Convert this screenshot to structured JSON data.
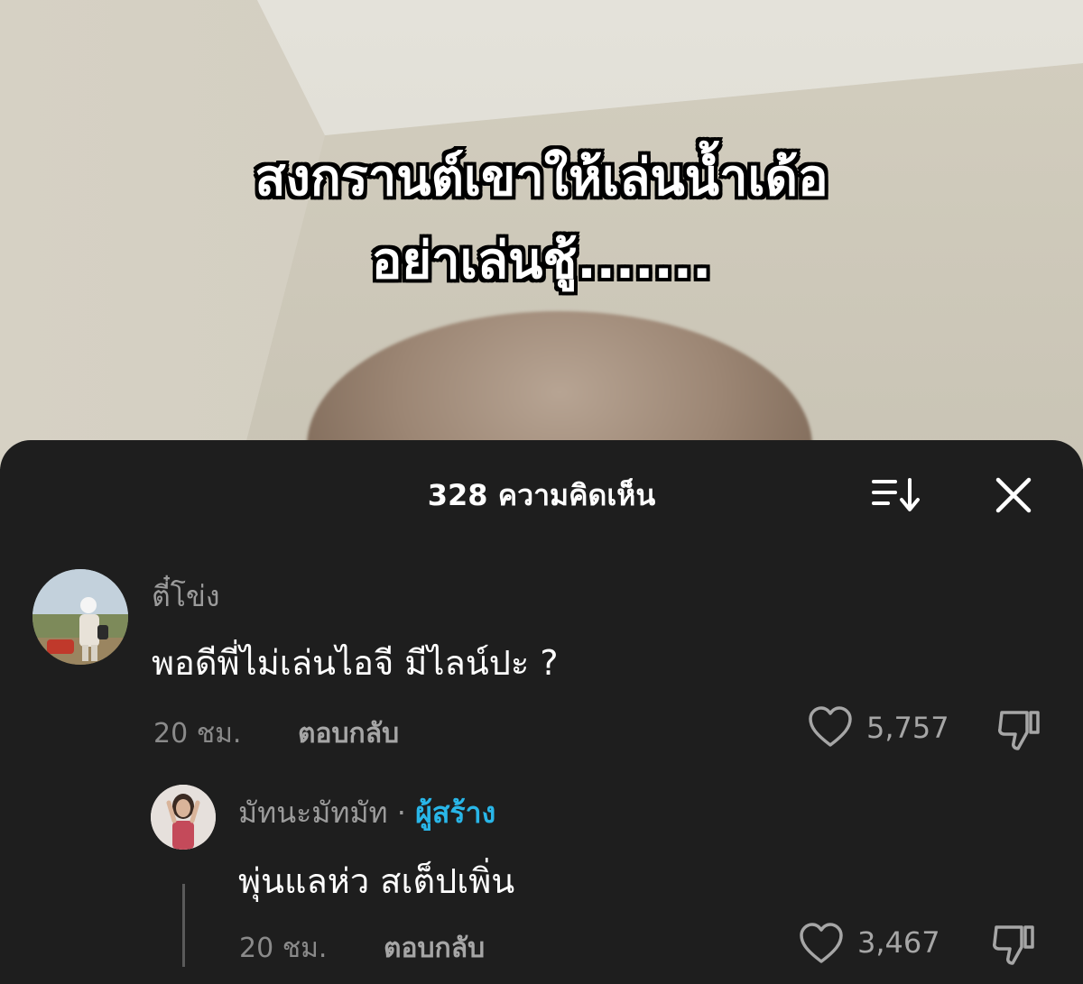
{
  "video": {
    "caption_line1": "สงกรานต์เขาให้เล่นน้ำเด้อ",
    "caption_line2": "อย่าเล่นชู้......."
  },
  "comments_panel": {
    "title": "328 ความคิดเห็น",
    "sort_icon": "sort-icon",
    "close_icon": "close-icon"
  },
  "comments": [
    {
      "username": "ตี๋โข่ง",
      "text": "พอดีพี่ไม่เล่นไอจี มีไลน์ปะ ?",
      "time": "20 ชม.",
      "reply_label": "ตอบกลับ",
      "likes": "5,757"
    }
  ],
  "replies": [
    {
      "username": "มัทนะมัทมัท",
      "separator": "·",
      "creator_label": "ผู้สร้าง",
      "text": "พุ่นแลห่ว สเต็ปเพิ่น",
      "time": "20 ชม.",
      "reply_label": "ตอบกลับ",
      "likes": "3,467"
    }
  ],
  "colors": {
    "sheet_bg": "#1e1e1e",
    "creator_accent": "#29b6e8"
  }
}
